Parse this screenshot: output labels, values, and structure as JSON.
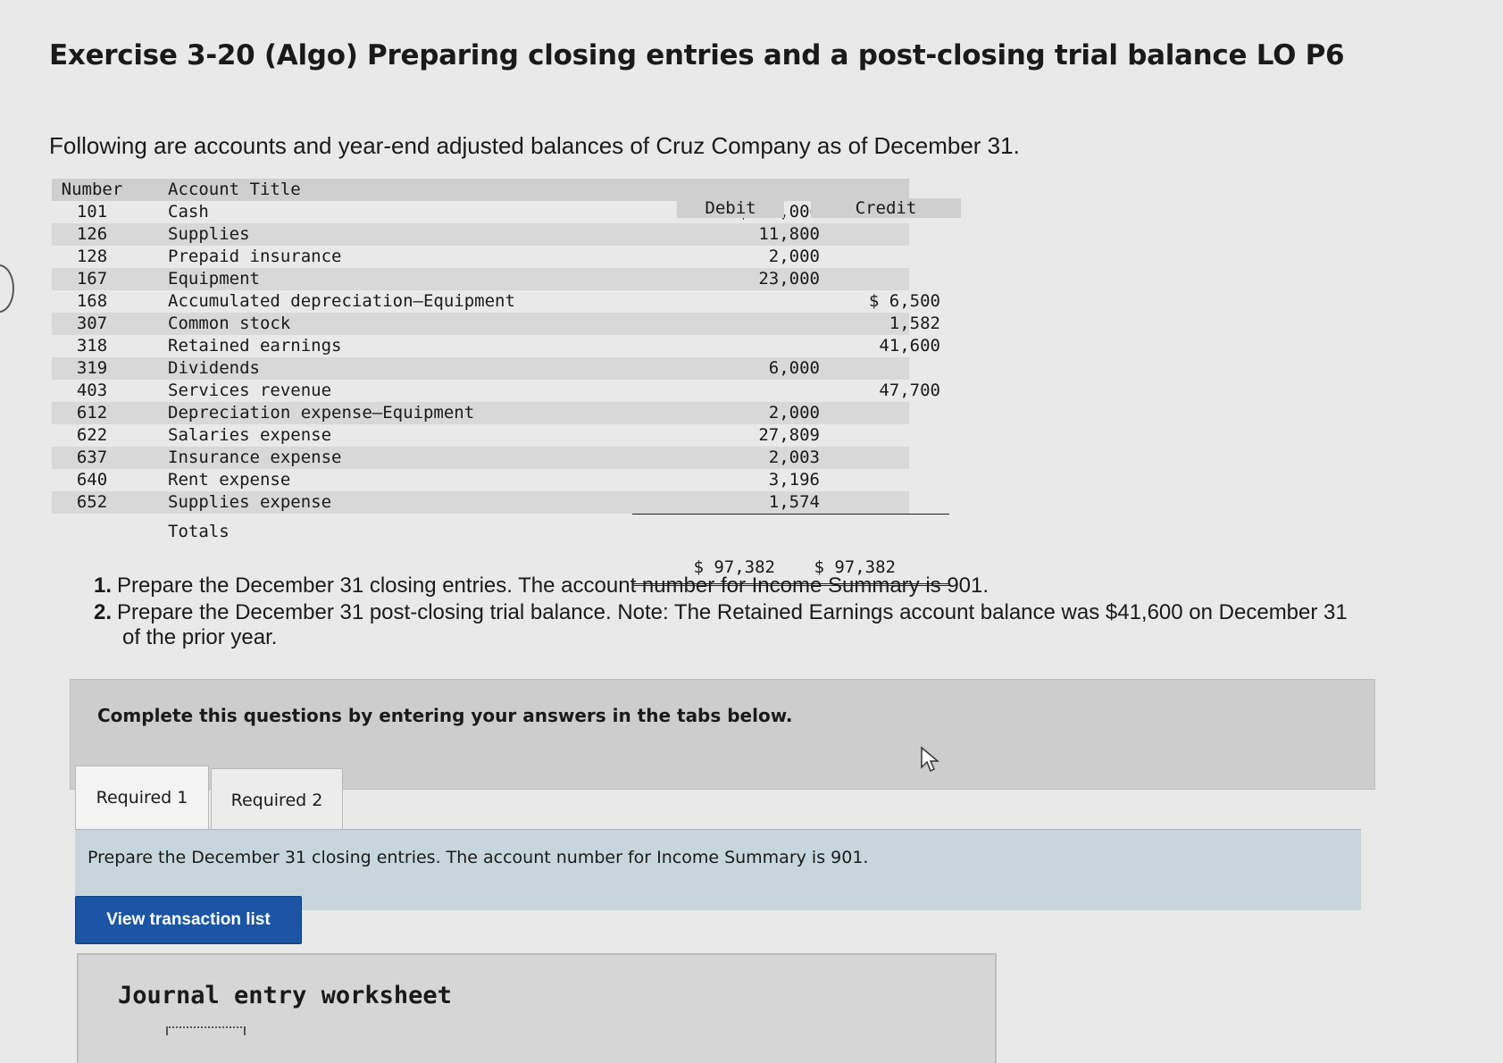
{
  "title": "Exercise 3-20 (Algo) Preparing closing entries and a post-closing trial balance LO P6",
  "intro": "Following are accounts and year-end adjusted balances of Cruz Company as of December 31.",
  "table": {
    "headers": {
      "number": "Number",
      "title": "Account Title",
      "debit": "Debit",
      "credit": "Credit"
    },
    "rows": [
      {
        "number": "101",
        "title": "Cash",
        "debit": "$ 18,000",
        "credit": ""
      },
      {
        "number": "126",
        "title": "Supplies",
        "debit": "11,800",
        "credit": ""
      },
      {
        "number": "128",
        "title": "Prepaid insurance",
        "debit": "2,000",
        "credit": ""
      },
      {
        "number": "167",
        "title": "Equipment",
        "debit": "23,000",
        "credit": ""
      },
      {
        "number": "168",
        "title": "Accumulated depreciation—Equipment",
        "debit": "",
        "credit": "$ 6,500"
      },
      {
        "number": "307",
        "title": "Common stock",
        "debit": "",
        "credit": "1,582"
      },
      {
        "number": "318",
        "title": "Retained earnings",
        "debit": "",
        "credit": "41,600"
      },
      {
        "number": "319",
        "title": "Dividends",
        "debit": "6,000",
        "credit": ""
      },
      {
        "number": "403",
        "title": "Services revenue",
        "debit": "",
        "credit": "47,700"
      },
      {
        "number": "612",
        "title": "Depreciation expense—Equipment",
        "debit": "2,000",
        "credit": ""
      },
      {
        "number": "622",
        "title": "Salaries expense",
        "debit": "27,809",
        "credit": ""
      },
      {
        "number": "637",
        "title": "Insurance expense",
        "debit": "2,003",
        "credit": ""
      },
      {
        "number": "640",
        "title": "Rent expense",
        "debit": "3,196",
        "credit": ""
      },
      {
        "number": "652",
        "title": "Supplies expense",
        "debit": "1,574",
        "credit": ""
      }
    ],
    "totals": {
      "label": "Totals",
      "debit": "$ 97,382",
      "credit": "$ 97,382"
    }
  },
  "instructions": {
    "item1_num": "1.",
    "item1": "Prepare the December 31 closing entries. The account number for Income Summary is 901.",
    "item2_num": "2.",
    "item2": "Prepare the December 31 post-closing trial balance. Note: The Retained Earnings account balance was $41,600 on December 31",
    "item2_cont": "of the prior year."
  },
  "panel_text": "Complete this questions by entering your answers in the tabs below.",
  "tabs": [
    "Required 1",
    "Required 2"
  ],
  "required_text": "Prepare the December 31 closing entries. The account number for Income Summary is 901.",
  "view_button": "View transaction list",
  "worksheet_title": "Journal entry worksheet",
  "colors": {
    "button_blue": "#1b55a3",
    "required_bar": "#c7d6dc"
  }
}
